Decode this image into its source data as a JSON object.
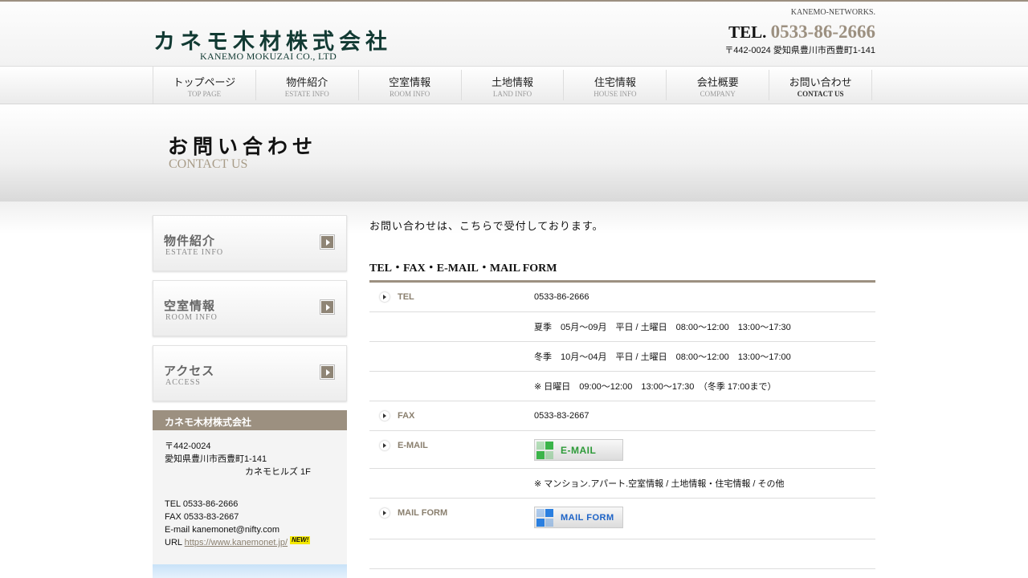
{
  "header": {
    "logo_ja": "カネモ木材株式会社",
    "logo_en": "KANEMO MOKUZAI CO., LTD",
    "networks": "KANEMO-NETWORKS.",
    "tel_prefix": "TEL.",
    "tel_number": "0533-86-2666",
    "address": "〒442-0024 愛知県豊川市西豊町1-141"
  },
  "nav": [
    {
      "ja": "トップページ",
      "en": "TOP PAGE"
    },
    {
      "ja": "物件紹介",
      "en": "ESTATE INFO"
    },
    {
      "ja": "空室情報",
      "en": "ROOM INFO"
    },
    {
      "ja": "土地情報",
      "en": "LAND INFO"
    },
    {
      "ja": "住宅情報",
      "en": "HOUSE INFO"
    },
    {
      "ja": "会社概要",
      "en": "COMPANY"
    },
    {
      "ja": "お問い合わせ",
      "en": "CONTACT US"
    }
  ],
  "page_title": {
    "ja": "お問い合わせ",
    "en": "CONTACT US"
  },
  "sidebar": {
    "buttons": [
      {
        "ja": "物件紹介",
        "en": "ESTATE INFO"
      },
      {
        "ja": "空室情報",
        "en": "ROOM INFO"
      },
      {
        "ja": "アクセス",
        "en": "ACCESS"
      }
    ],
    "company": {
      "title": "カネモ木材株式会社",
      "postal": "〒442-0024",
      "addr1": "愛知県豊川市西豊町1-141",
      "addr2": "カネモヒルズ 1F",
      "tel": "TEL 0533-86-2666",
      "fax": "FAX 0533-83-2667",
      "email": "E-mail kanemonet@nifty.com",
      "url_prefix": "URL ",
      "url": "https://www.kanemonet.jp/",
      "new_badge": "NEW!"
    }
  },
  "main": {
    "intro": "お問い合わせは、こちらで受付しております。",
    "section_title": "TEL・FAX・E-MAIL・MAIL FORM",
    "rows": {
      "tel_label": "TEL",
      "tel_value": "0533-86-2666",
      "summer": "夏季　05月～09月　平日 / 土曜日　08:00～12:00　13:00～17:30",
      "winter": "冬季　10月～04月　平日 / 土曜日　08:00～12:00　13:00～17:00",
      "sunday": "※ 日曜日　09:00～12:00　13:00～17:30　（冬季 17:00まで）",
      "fax_label": "FAX",
      "fax_value": "0533-83-2667",
      "email_label": "E-MAIL",
      "email_button": "E-MAIL",
      "email_note": "※ マンション.アパート.空室情報 / 土地情報・住宅情報 / その他",
      "mailform_label": "MAIL FORM",
      "mailform_button": "MAIL FORM"
    }
  },
  "colors": {
    "accent": "#9c9080",
    "logo": "#123a33"
  }
}
